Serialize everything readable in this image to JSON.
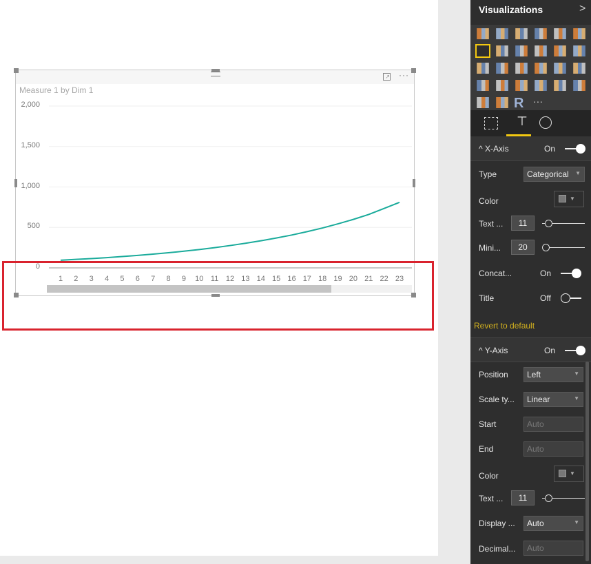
{
  "visual": {
    "title": "Measure 1 by Dim 1",
    "focus_icon": "focus-mode-icon",
    "more_icon": "more-options-icon"
  },
  "chart_data": {
    "type": "line",
    "title": "Measure 1 by Dim 1",
    "xlabel": "",
    "ylabel": "",
    "categories": [
      "1",
      "2",
      "3",
      "4",
      "5",
      "6",
      "7",
      "8",
      "9",
      "10",
      "11",
      "12",
      "13",
      "14",
      "15",
      "16",
      "17",
      "18",
      "19",
      "20",
      "21",
      "22",
      "23"
    ],
    "values": [
      95,
      105,
      115,
      127,
      140,
      154,
      170,
      187,
      206,
      227,
      250,
      276,
      304,
      335,
      369,
      406,
      448,
      493,
      544,
      599,
      660,
      735,
      810
    ],
    "yticks": [
      "2,000",
      "1,500",
      "1,000",
      "500",
      "0"
    ],
    "ylim": [
      0,
      2000
    ],
    "grid": true,
    "line_color": "#1aab9b",
    "scrollbar_visible_fraction": 0.78
  },
  "highlight_color": "#d9232e",
  "panel": {
    "title": "Visualizations",
    "collapse_icon": "chevron-right-icon",
    "viz_icons": [
      "stacked-bar-icon",
      "stacked-column-icon",
      "clustered-bar-icon",
      "clustered-column-icon",
      "100-stacked-bar-icon",
      "100-stacked-column-icon",
      "line-chart-icon",
      "area-chart-icon",
      "stacked-area-icon",
      "line-column-icon",
      "line-clustered-column-icon",
      "ribbon-chart-icon",
      "scatter-icon",
      "pie-icon",
      "treemap-icon",
      "map-icon",
      "table-icon",
      "matrix-icon",
      "filled-map-icon",
      "funnel-icon",
      "gauge-icon",
      "multi-row-card-icon",
      "card-icon",
      "kpi-icon",
      "slicer-icon",
      "donut-icon",
      "r-visual-icon",
      "more-visuals-icon"
    ],
    "selected_viz": "line-chart-icon",
    "tabs": [
      "fields-icon",
      "format-paintroller-icon",
      "analytics-icon"
    ],
    "x_axis": {
      "header": "X-Axis",
      "state": "On",
      "type_label": "Type",
      "type_value": "Categorical",
      "color_label": "Color",
      "text_label": "Text ...",
      "text_value": "11",
      "mini_label": "Mini...",
      "mini_value": "20",
      "concat_label": "Concat...",
      "concat_state": "On",
      "title_label": "Title",
      "title_state": "Off",
      "revert": "Revert to default"
    },
    "y_axis": {
      "header": "Y-Axis",
      "state": "On",
      "position_label": "Position",
      "position_value": "Left",
      "scale_label": "Scale ty...",
      "scale_value": "Linear",
      "start_label": "Start",
      "start_placeholder": "Auto",
      "end_label": "End",
      "end_placeholder": "Auto",
      "color_label": "Color",
      "text_label": "Text ...",
      "text_value": "11",
      "display_label": "Display ...",
      "display_value": "Auto",
      "decimal_label": "Decimal...",
      "decimal_placeholder": "Auto"
    },
    "accent_color": "#f2c811"
  }
}
